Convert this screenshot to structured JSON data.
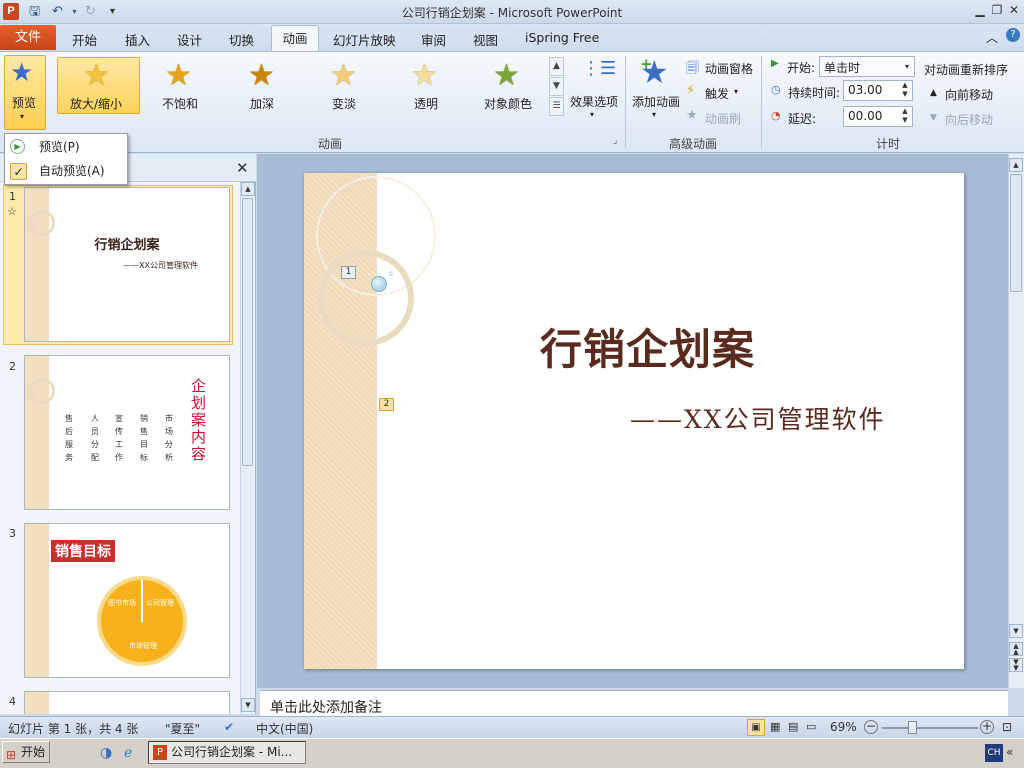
{
  "window": {
    "title": "公司行销企划案 - Microsoft PowerPoint",
    "app_icon": "P"
  },
  "ribbon_tabs": [
    "开始",
    "插入",
    "设计",
    "切换",
    "动画",
    "幻灯片放映",
    "审阅",
    "视图",
    "iSpring Free"
  ],
  "file_tab": "文件",
  "preview": {
    "label": "预览"
  },
  "animations": {
    "items": [
      "放大/缩小",
      "不饱和",
      "加深",
      "变淡",
      "透明",
      "对象颜色"
    ],
    "effect_options": "效果选项",
    "group_label": "动画"
  },
  "advanced": {
    "add_animation": "添加动画",
    "animation_pane": "动画窗格",
    "trigger": "触发",
    "animation_painter": "动画刷",
    "group_label": "高级动画"
  },
  "timing": {
    "start_label": "开始:",
    "start_value": "单击时",
    "duration_label": "持续时间:",
    "duration_value": "03.00",
    "delay_label": "延迟:",
    "delay_value": "00.00",
    "reorder_label": "对动画重新排序",
    "move_earlier": "向前移动",
    "move_later": "向后移动",
    "group_label": "计时"
  },
  "preview_menu": {
    "items": [
      "预览(P)",
      "自动预览(A)"
    ]
  },
  "slides": [
    {
      "number": "1",
      "title": "行销企划案",
      "subtitle": "——XX公司管理软件",
      "glyph": "☆"
    },
    {
      "number": "2",
      "heading": "企划案内容",
      "columns": [
        "售后服务",
        "人员分配",
        "宣传工作",
        "销售目标",
        "市场分析"
      ]
    },
    {
      "number": "3",
      "heading": "销售目标",
      "segments": [
        "图书市场",
        "公司管理",
        "市场管理"
      ]
    },
    {
      "number": "4"
    }
  ],
  "main_slide": {
    "title": "行销企划案",
    "subtitle": "——XX公司管理软件",
    "markers": [
      "1",
      "2"
    ],
    "marker_small": "0"
  },
  "notes_placeholder": "单击此处添加备注",
  "statusbar": {
    "slide_info": "幻灯片 第 1 张，共 4 张",
    "theme": "\"夏至\"",
    "language": "中文(中国)",
    "zoom": "69%"
  },
  "taskbar": {
    "start": "开始",
    "item": "公司行销企划案 - Mi...",
    "ime": "CH"
  },
  "colors": {
    "file_tab": "#c7431a",
    "accent_orange": "#f7b21b",
    "title_brown": "#5a2a1c",
    "red_heading": "#c8102e"
  }
}
